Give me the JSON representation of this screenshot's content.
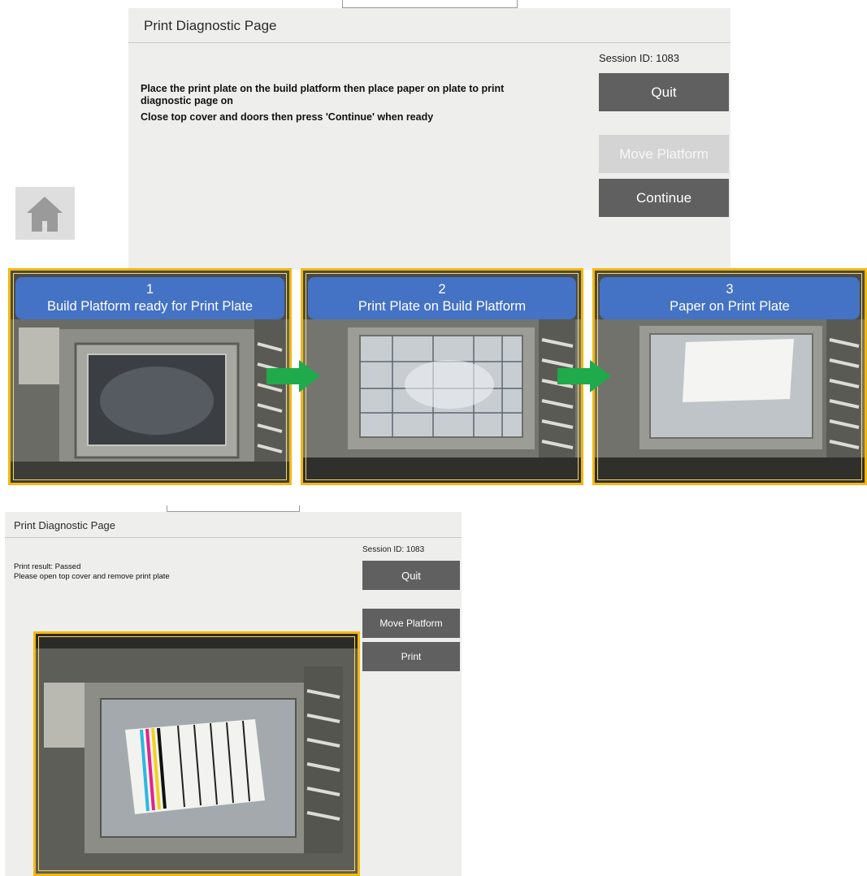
{
  "top_screen": {
    "title": "Print Diagnostic Page",
    "session": "Session ID: 1083",
    "instruction_1": "Place the print plate on the build platform then place paper on plate to print diagnostic page on",
    "instruction_2": "Close top cover and doors then press 'Continue' when ready",
    "buttons": {
      "quit": "Quit",
      "move_platform": "Move Platform",
      "continue": "Continue"
    }
  },
  "home": {
    "icon": "home-icon"
  },
  "steps": [
    {
      "number": "1",
      "label": "Build Platform ready for Print Plate"
    },
    {
      "number": "2",
      "label": "Print Plate on Build Platform"
    },
    {
      "number": "3",
      "label": "Paper on Print Plate"
    }
  ],
  "bottom_screen": {
    "title": "Print Diagnostic Page",
    "session": "Session ID: 1083",
    "result": "Print result: Passed",
    "instruction": "Please open top cover and remove print plate",
    "buttons": {
      "quit": "Quit",
      "move_platform": "Move Platform",
      "print": "Print"
    }
  },
  "colors": {
    "frame_border": "#f3b80c",
    "caption_bg": "#4472c4",
    "arrow": "#1faa4b",
    "button": "#606060",
    "button_disabled": "#d4d4d4"
  }
}
